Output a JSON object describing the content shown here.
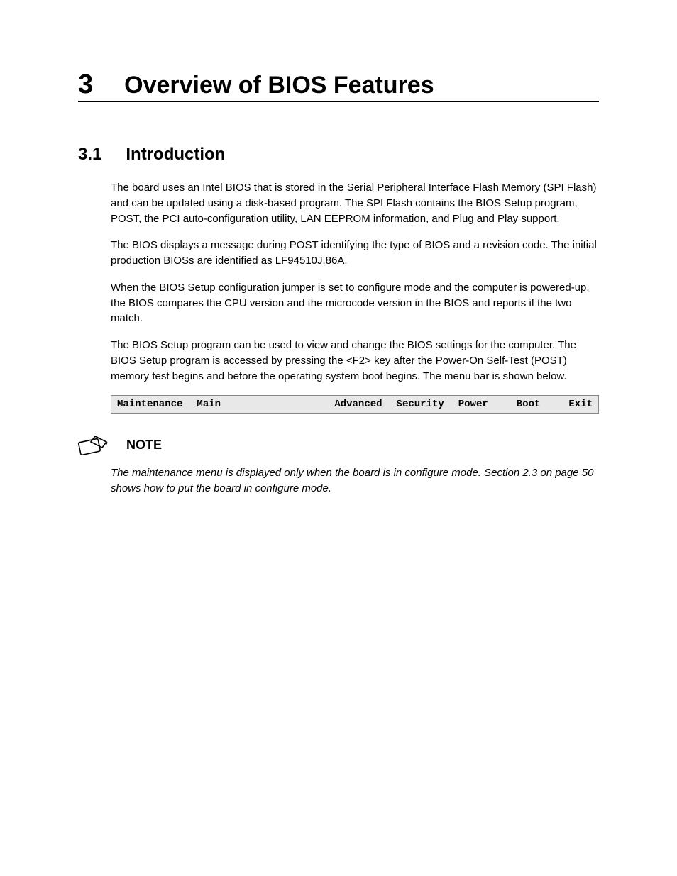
{
  "chapter": {
    "number": "3",
    "title": "Overview of BIOS Features"
  },
  "section": {
    "number": "3.1",
    "title": "Introduction"
  },
  "paragraphs": {
    "p1": "The board uses an Intel BIOS that is stored in the Serial Peripheral Interface Flash Memory (SPI Flash) and can be updated using a disk-based program.  The SPI Flash contains the BIOS Setup program, POST, the PCI auto-configuration utility, LAN EEPROM information, and Plug and Play support.",
    "p2": "The BIOS displays a message during POST identifying the type of BIOS and a revision code.  The initial production BIOSs are identified as LF94510J.86A.",
    "p3": "When the BIOS Setup configuration jumper is set to configure mode and the computer is powered-up, the BIOS compares the CPU version and the microcode version in the BIOS and reports if the two match.",
    "p4": "The BIOS Setup program can be used to view and change the BIOS settings for the computer.  The BIOS Setup program is accessed by pressing the <F2> key after the Power-On Self-Test (POST) memory test begins and before the operating system boot begins.  The menu bar is shown below."
  },
  "menu_items": {
    "i0": "Maintenance",
    "i1": "Main",
    "i2": "Advanced",
    "i3": "Security",
    "i4": "Power",
    "i5": "Boot",
    "i6": "Exit"
  },
  "note": {
    "label": "NOTE",
    "text": "The maintenance menu is displayed only when the board is in configure mode. Section 2.3 on page 50 shows how to put the board in configure mode."
  }
}
